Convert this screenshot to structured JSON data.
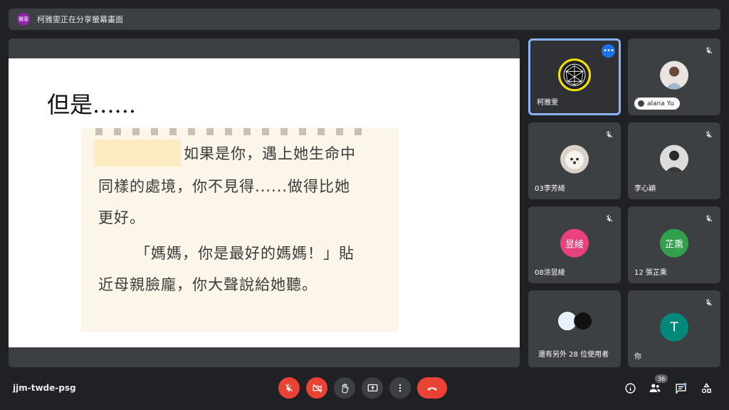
{
  "banner": {
    "avatar_text": "雅雯",
    "text": "柯雅雯正在分享螢幕畫面"
  },
  "slide": {
    "title": "但是......",
    "lines": [
      "如果是你，遇上她生命中",
      "同樣的處境，你不見得......做得比她",
      "更好。",
      "「媽媽，你是最好的媽媽！」貼",
      "近母親臉龐，你大聲說給她聽。"
    ]
  },
  "participants": [
    {
      "name": "柯雅雯",
      "avatar": "globe-logo",
      "presenting": true
    },
    {
      "name": "alana Yu",
      "avatar": "photo",
      "muted": true
    },
    {
      "name": "03李芳綺",
      "avatar": "photo-dog",
      "muted": true
    },
    {
      "name": "李心穎",
      "avatar": "photo",
      "muted": true
    },
    {
      "name": "08涂昱綾",
      "avatar_text": "昱綾",
      "color": "#e8417e",
      "muted": true
    },
    {
      "name": "12 張芷熏",
      "avatar_text": "芷熏",
      "color": "#33a04e",
      "muted": true
    },
    {
      "name": "還有另外 28 位使用者",
      "avatar": "group"
    },
    {
      "name": "你",
      "avatar_text": "T",
      "color": "#00897b",
      "muted": true
    }
  ],
  "meeting": {
    "code": "jjm-twde-psg",
    "people_count": "36"
  }
}
